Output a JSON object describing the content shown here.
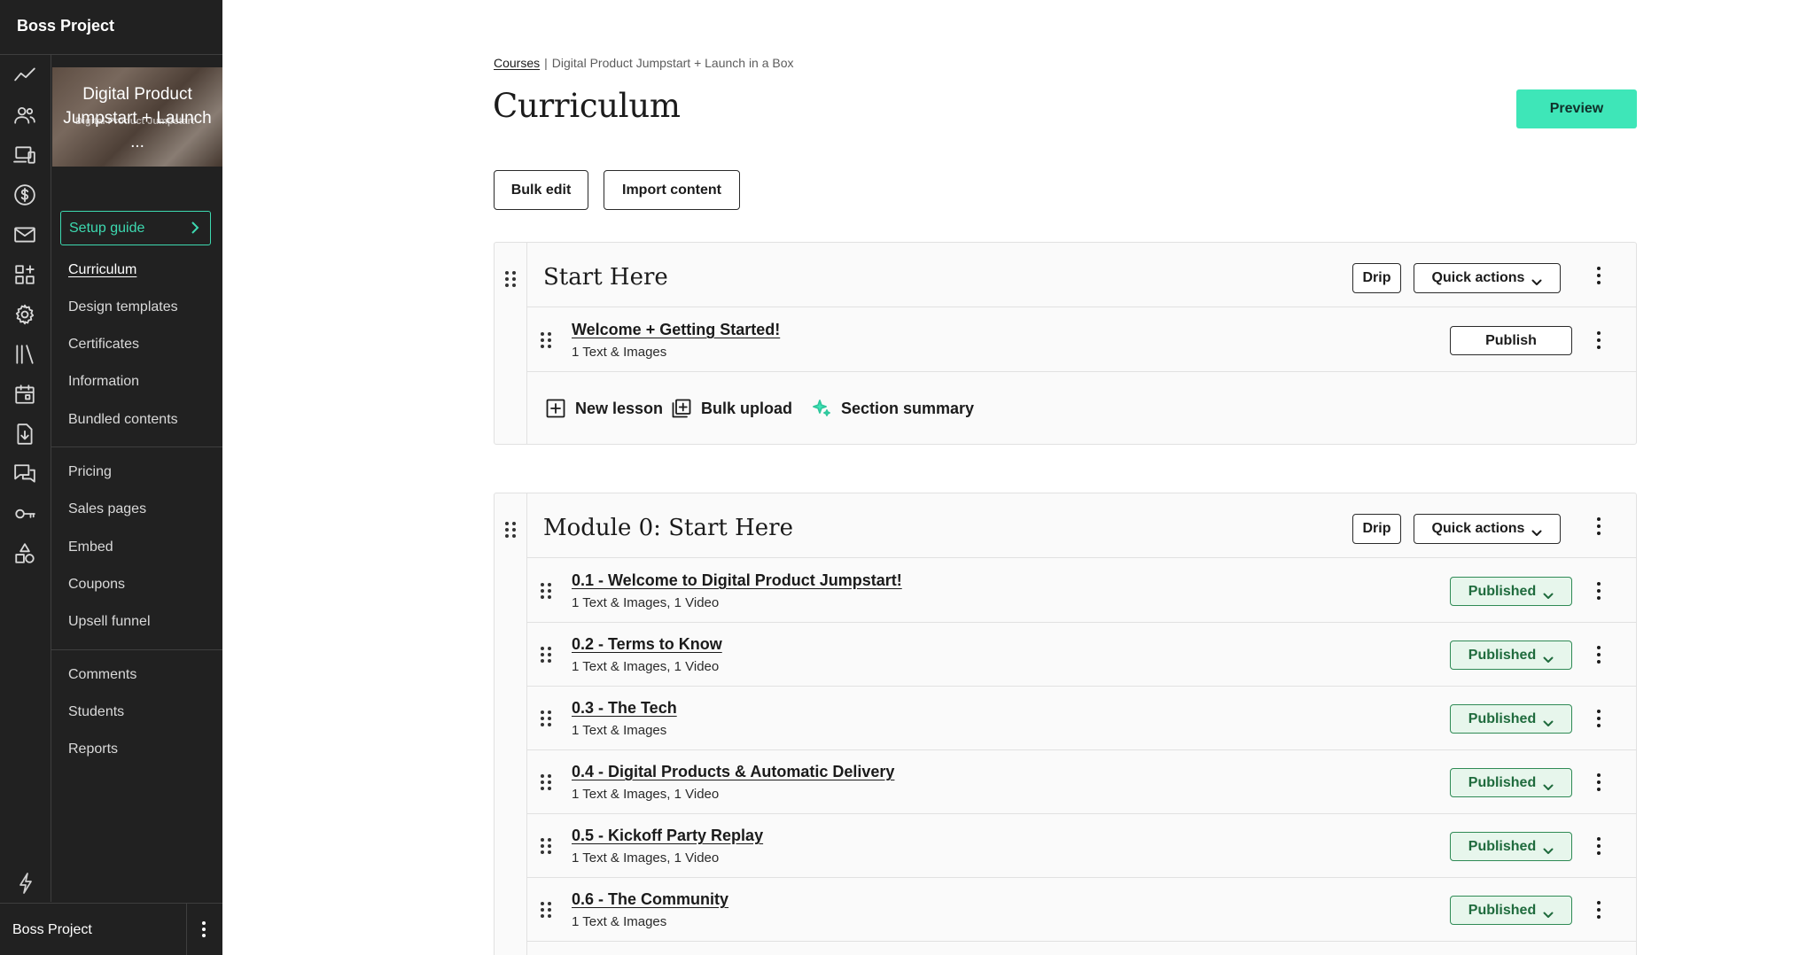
{
  "school": {
    "name": "Boss Project"
  },
  "sidebar": {
    "rail_icons": [
      "analytics-icon",
      "users-icon",
      "devices-icon",
      "dollar-icon",
      "mail-icon",
      "apps-icon",
      "gear-icon",
      "library-icon",
      "calendar-icon",
      "download-icon",
      "comments-icon",
      "key-icon",
      "shapes-icon"
    ],
    "course_card": {
      "title": "Digital Product Jumpstart + Launch ...",
      "ghost_text": "Digital Product Jumpstart"
    },
    "setup_guide_label": "Setup guide",
    "group1": [
      "Curriculum",
      "Design templates",
      "Certificates",
      "Information",
      "Bundled contents"
    ],
    "group2": [
      "Pricing",
      "Sales pages",
      "Embed",
      "Coupons",
      "Upsell funnel"
    ],
    "group3": [
      "Comments",
      "Students",
      "Reports"
    ],
    "active_item": "Curriculum",
    "footer_name": "Boss Project"
  },
  "breadcrumb": {
    "root": "Courses",
    "separator": "|",
    "current": "Digital Product Jumpstart + Launch in a Box"
  },
  "page": {
    "title": "Curriculum",
    "preview_label": "Preview",
    "bulk_edit_label": "Bulk edit",
    "import_label": "Import content"
  },
  "colors": {
    "accent": "#3ee6b8",
    "sidebar_bg": "#212121",
    "published_bg": "#e7f6ec",
    "published_text": "#1f6b3d",
    "setup_guide": "#3dd9b0"
  },
  "sections": [
    {
      "title": "Start Here",
      "drip_label": "Drip",
      "quick_actions_label": "Quick actions",
      "lessons": [
        {
          "title": "Welcome + Getting Started!",
          "meta": "1 Text & Images",
          "status": "Publish"
        }
      ],
      "footer_actions": [
        "New lesson",
        "Bulk upload",
        "Section summary"
      ]
    },
    {
      "title": "Module 0: Start Here",
      "drip_label": "Drip",
      "quick_actions_label": "Quick actions",
      "lessons": [
        {
          "title": "0.1 - Welcome to Digital Product Jumpstart!",
          "meta": "1 Text & Images, 1 Video",
          "status": "Published"
        },
        {
          "title": "0.2 - Terms to Know",
          "meta": "1 Text & Images, 1 Video",
          "status": "Published"
        },
        {
          "title": "0.3 - The Tech",
          "meta": "1 Text & Images",
          "status": "Published"
        },
        {
          "title": "0.4 - Digital Products & Automatic Delivery",
          "meta": "1 Text & Images, 1 Video",
          "status": "Published"
        },
        {
          "title": "0.5 - Kickoff Party Replay",
          "meta": "1 Text & Images, 1 Video",
          "status": "Published"
        },
        {
          "title": "0.6 - The Community",
          "meta": "1 Text & Images",
          "status": "Published"
        }
      ]
    }
  ]
}
